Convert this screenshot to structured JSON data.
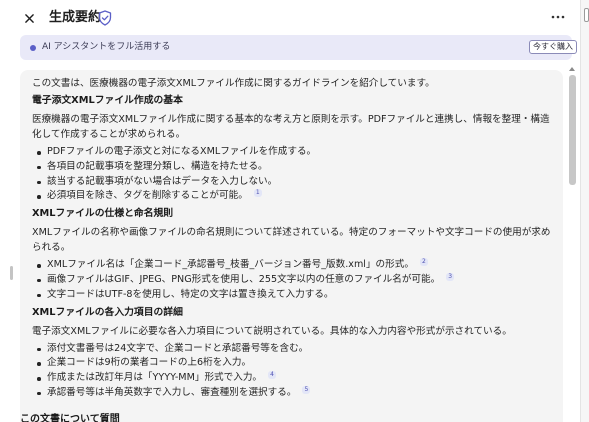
{
  "header": {
    "title": "生成要約",
    "close_icon": "close-icon",
    "shield_icon": "shield-check-icon",
    "more_icon": "more-horizontal-icon"
  },
  "banner": {
    "text": "AI アシスタントをフル活用する",
    "button_label": "今すぐ購入"
  },
  "content": {
    "intro": "この文書は、医療機器の電子添文XMLファイル作成に関するガイドラインを紹介しています。",
    "sections": [
      {
        "heading": "電子添文XMLファイル作成の基本",
        "body": "医療機器の電子添文XMLファイル作成に関する基本的な考え方と原則を示す。PDFファイルと連携し、情報を整理・構造化して作成することが求められる。",
        "items": [
          {
            "text": "PDFファイルの電子添文と対になるXMLファイルを作成する。",
            "cite": ""
          },
          {
            "text": "各項目の記載事項を整理分類し、構造を持たせる。",
            "cite": ""
          },
          {
            "text": "該当する記載事項がない場合はデータを入力しない。",
            "cite": ""
          },
          {
            "text": "必須項目を除き、タグを削除することが可能。",
            "cite": "1"
          }
        ]
      },
      {
        "heading": "XMLファイルの仕様と命名規則",
        "body": "XMLファイルの名称や画像ファイルの命名規則について詳述されている。特定のフォーマットや文字コードの使用が求められる。",
        "items": [
          {
            "text": "XMLファイル名は「企業コード_承認番号_枝番_バージョン番号_版数.xml」の形式。",
            "cite": "2"
          },
          {
            "text": "画像ファイルはGIF、JPEG、PNG形式を使用し、255文字以内の任意のファイル名が可能。",
            "cite": "3"
          },
          {
            "text": "文字コードはUTF-8を使用し、特定の文字は置き換えて入力する。",
            "cite": ""
          }
        ]
      },
      {
        "heading": "XMLファイルの各入力項目の詳細",
        "body": "電子添文XMLファイルに必要な各入力項目について説明されている。具体的な入力内容や形式が示されている。",
        "items": [
          {
            "text": "添付文書番号は24文字で、企業コードと承認番号等を含む。",
            "cite": ""
          },
          {
            "text": "企業コードは9桁の業者コードの上6桁を入力。",
            "cite": ""
          },
          {
            "text": "作成または改訂年月は「YYYY-MM」形式で入力。",
            "cite": "4"
          },
          {
            "text": "承認番号等は半角英数字で入力し、審査種別を選択する。",
            "cite": "5"
          }
        ]
      }
    ]
  },
  "footer": {
    "label": "この文書について質問"
  },
  "colors": {
    "accent": "#5b5fc7",
    "banner_bg": "#e9e9f8",
    "card_bg": "#f4f4f4"
  }
}
